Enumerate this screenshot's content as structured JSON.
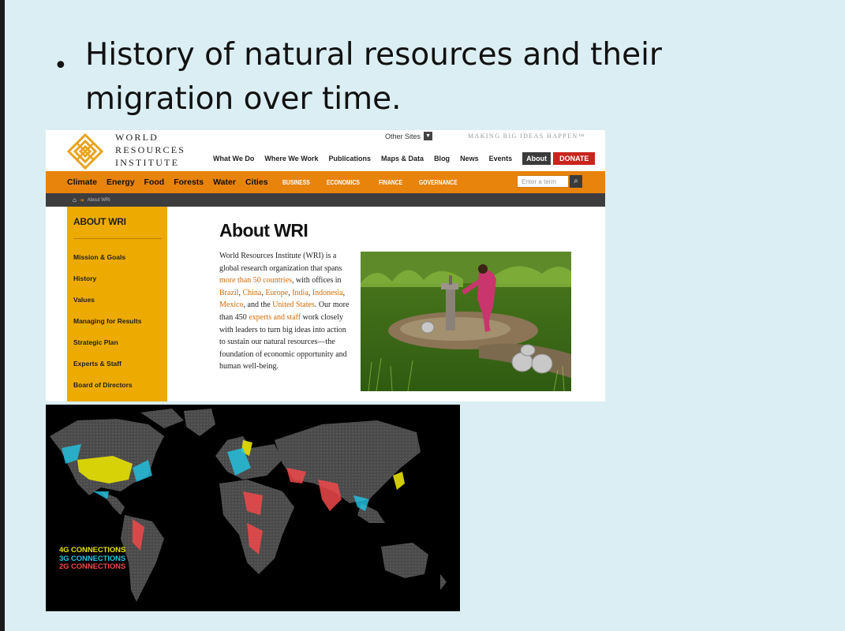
{
  "slide": {
    "bullet_line1": "History of natural resources and their",
    "bullet_line2": "migration over time."
  },
  "wri": {
    "logo_lines": [
      "WORLD",
      "RESOURCES",
      "INSTITUTE"
    ],
    "other_sites": "Other Sites",
    "tagline": "MAKING BIG IDEAS HAPPEN™",
    "top_nav": [
      "What We Do",
      "Where We Work",
      "Publications",
      "Maps & Data",
      "Blog",
      "News",
      "Events"
    ],
    "about_btn": "About",
    "donate_btn": "DONATE",
    "topics": [
      "Climate",
      "Energy",
      "Food",
      "Forests",
      "Water",
      "Cities"
    ],
    "sections": [
      "BUSINESS",
      "ECONOMICS",
      "FINANCE",
      "GOVERNANCE"
    ],
    "search_placeholder": "Enter a term",
    "breadcrumb": "About WRI",
    "sidebar": {
      "title": "ABOUT WRI",
      "items": [
        "Mission & Goals",
        "History",
        "Values",
        "Managing for Results",
        "Strategic Plan",
        "Experts & Staff",
        "Board of Directors"
      ]
    },
    "page_title": "About WRI",
    "body": {
      "t1": "World Resources Institute (WRI) is a global research organization that spans ",
      "l1": "more than 50 countries",
      "t2": ", with offices in ",
      "l2": "Brazil",
      "t3": ", ",
      "l3": "China",
      "t4": ", ",
      "l4": "Europe",
      "t5": ", ",
      "l5": "India",
      "t6": ", ",
      "l6": "Indonesia",
      "t7": ", ",
      "l7": "Mexico",
      "t8": ", and the ",
      "l8": "United States",
      "t9": ". Our more than 450 ",
      "l9": "experts and staff",
      "t10": " work closely with leaders to turn big ideas into action to sustain our natural resources—the foundation of economic opportunity and human well-being."
    }
  },
  "map": {
    "legend": [
      "4G CONNECTIONS",
      "3G CONNECTIONS",
      "2G CONNECTIONS"
    ],
    "colors": {
      "4g": "#e7e100",
      "3g": "#22c5e6",
      "2g": "#f0484a"
    }
  }
}
